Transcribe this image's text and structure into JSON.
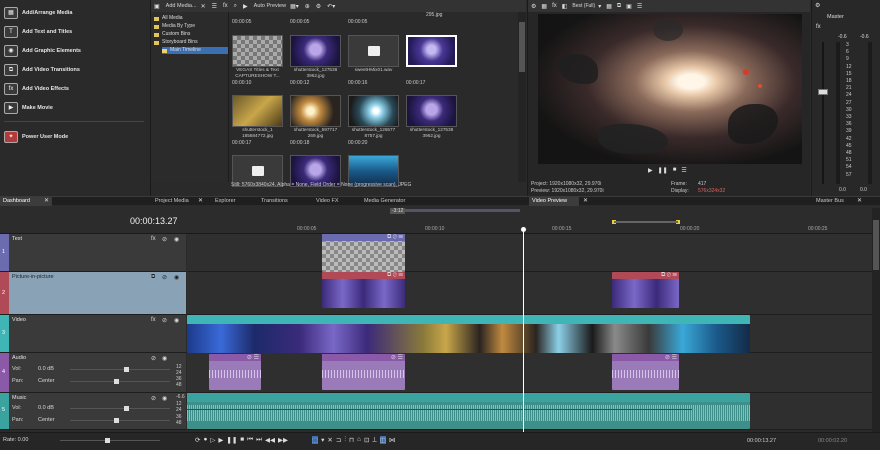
{
  "dashboard": {
    "items": [
      {
        "label": "Add/Arrange Media",
        "icon": "film-icon"
      },
      {
        "label": "Add Text and Titles",
        "icon": "text-icon"
      },
      {
        "label": "Add Graphic Elements",
        "icon": "graphic-icon"
      },
      {
        "label": "Add Video Transitions",
        "icon": "transition-icon"
      },
      {
        "label": "Add Video Effects",
        "icon": "fx-icon"
      },
      {
        "label": "Make Movie",
        "icon": "movie-icon"
      },
      {
        "label": "Power User Mode",
        "icon": "power-icon"
      }
    ]
  },
  "media": {
    "toolbar": {
      "add_media": "Add Media...",
      "preview": "Auto Preview"
    },
    "tree": [
      "All Media",
      "Media By Type",
      "Custom Bins",
      "Storyboard Bins",
      "Main Timeline"
    ],
    "thumbs": [
      {
        "ts": "00:00:05",
        "cap": "VEGAS Titles & Text CAPTURESHOW T...",
        "kind": "checker"
      },
      {
        "ts": "00:00:05",
        "cap": "shutterstock_127538 3962.jpg",
        "kind": "person"
      },
      {
        "ts": "00:00:05",
        "cap": "sweetHMix01.wav",
        "kind": "audio"
      },
      {
        "ts": "",
        "cap": "",
        "kind": "person-white"
      },
      {
        "ts": "00:00:10",
        "cap": "shutterstock_1 185684772.jpg",
        "kind": "maze"
      },
      {
        "ts": "00:00:12",
        "cap": "shutterstock_597717 269.jpg",
        "kind": "explosion"
      },
      {
        "ts": "00:00:16",
        "cap": "shutterstock_126577 8757.jpg",
        "kind": "blast"
      },
      {
        "ts": "00:00:17",
        "cap": "shutterstock_127538 3962.jpg",
        "kind": "person"
      },
      {
        "ts": "00:00:17",
        "cap": "",
        "kind": "audio"
      },
      {
        "ts": "00:00:18",
        "cap": "",
        "kind": "person"
      },
      {
        "ts": "00:00:20",
        "cap": "",
        "kind": "stage"
      }
    ],
    "top_ts": [
      "00:00:05",
      "00:00:05",
      "00:00:05",
      "295.jpg"
    ],
    "status": "Still: 5760x3840x24, Alpha = None, Field Order = None (progressive scan), JPEG"
  },
  "tabs_left": [
    "Dashboard",
    "Project Media",
    "Explorer",
    "Transitions",
    "Video FX",
    "Media Generator"
  ],
  "preview": {
    "quality": "Best (Full)",
    "project": "Project:  1920x1080x32, 29.970i",
    "preview": "Preview:  1920x1080x32, 29.970i",
    "frame_label": "Frame:",
    "frame": "417",
    "display_label": "Display:",
    "display": "576x324x32",
    "tab": "Video Preview"
  },
  "master": {
    "title": "Master",
    "levels": [
      "-0.6",
      "-0.6"
    ],
    "scale": [
      "3",
      "6",
      "9",
      "12",
      "15",
      "18",
      "21",
      "24",
      "27",
      "30",
      "33",
      "36",
      "39",
      "42",
      "45",
      "48",
      "51",
      "54",
      "57"
    ],
    "bottom": [
      "0.0",
      "0.0"
    ],
    "tab": "Master Bus"
  },
  "timeline": {
    "timecode": "00:00:13.27",
    "ruler": [
      "00:00:05",
      "00:00:10",
      "00:00:15",
      "00:00:20",
      "00:00:25"
    ],
    "ruler_top": "-3:12",
    "tracks": [
      {
        "num": "1",
        "name": "Text"
      },
      {
        "num": "2",
        "name": "Picture-in-picture"
      },
      {
        "num": "3",
        "name": "Video"
      },
      {
        "num": "4",
        "name": "Audio",
        "vol_label": "Vol:",
        "vol": "0.0 dB",
        "pan_label": "Pan:",
        "pan": "Center"
      },
      {
        "num": "5",
        "name": "Music",
        "vol_label": "Vol:",
        "vol": "0.0 dB",
        "pan_label": "Pan:",
        "pan": "Center"
      }
    ],
    "db_labels": [
      "12",
      "24",
      "36",
      "48"
    ],
    "db_labels2": [
      "-6.6",
      "12",
      "24",
      "36",
      "48"
    ],
    "rate": "Rate: 0.00",
    "bottom_tc": "00:00:13.27",
    "bottom_tc2": "00:00:02.20"
  },
  "colors": {
    "text_track": "#6b6bb0",
    "pip_track": "#b04a56",
    "video_track": "#3fb5b5",
    "audio_track": "#8a5aa8",
    "music_track": "#3aa3a0"
  }
}
